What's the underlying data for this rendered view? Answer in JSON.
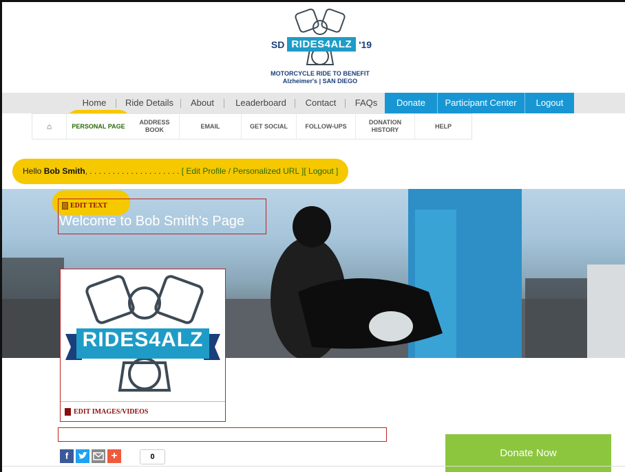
{
  "logo": {
    "sd": "SD",
    "name": "RIDES4ALZ",
    "year": "'19",
    "subtitle1": "MOTORCYCLE RIDE TO BENEFIT",
    "subtitle2": "Alzheimer's | SAN DIEGO"
  },
  "nav": {
    "items": [
      "Home",
      "Ride Details",
      "About",
      "Leaderboard",
      "Contact",
      "FAQs"
    ],
    "blue_items": [
      "Donate",
      "Participant Center",
      "Logout"
    ]
  },
  "subtabs": {
    "items": [
      "PERSONAL PAGE",
      "ADDRESS BOOK",
      "EMAIL",
      "GET SOCIAL",
      "FOLLOW-UPS",
      "DONATION\nHISTORY",
      "HELP"
    ]
  },
  "greeting": {
    "hello": "Hello ",
    "name": "Bob Smith",
    "dots": ", . . . . . . . . . . . . . . . . . . . . ",
    "links": "[ Edit Profile / Personalized URL ][ Logout ]"
  },
  "hero": {
    "edit_label": "EDIT TEXT",
    "welcome": "Welcome to Bob Smith's Page"
  },
  "card": {
    "banner": "RIDES4ALZ",
    "edit_label": "EDIT IMAGES/VIDEOS"
  },
  "donate_now": "Donate Now",
  "share": {
    "count": "0",
    "facebook": "f",
    "plus": "+"
  },
  "colors": {
    "highlight": "#f5c800",
    "nav_blue": "#1896d3",
    "donate_green": "#8cc63f",
    "edit_red": "#8a0d0d"
  }
}
